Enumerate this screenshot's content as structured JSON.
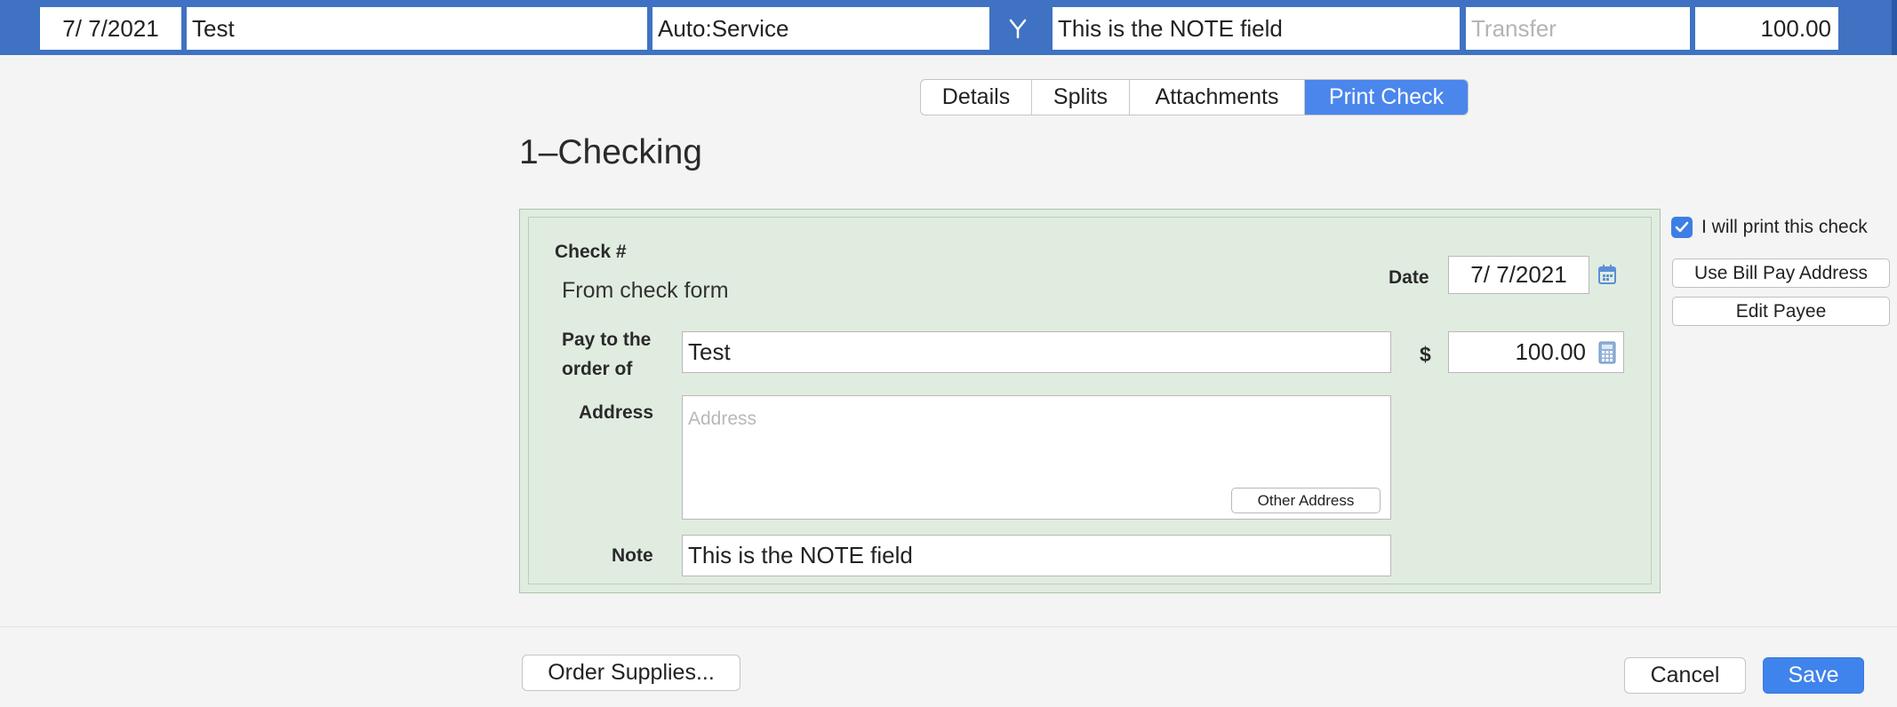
{
  "register": {
    "date": "7/  7/2021",
    "payee": "Test",
    "category": "Auto:Service",
    "memo": "This is the NOTE field",
    "transfer_placeholder": "Transfer",
    "amount": "100.00"
  },
  "tabs": [
    {
      "label": "Details",
      "active": false
    },
    {
      "label": "Splits",
      "active": false
    },
    {
      "label": "Attachments",
      "active": false
    },
    {
      "label": "Print Check",
      "active": true
    }
  ],
  "account_title": "1–Checking",
  "check": {
    "check_num_label": "Check #",
    "check_num_value": "From check form",
    "date_label": "Date",
    "date_value": "7/  7/2021",
    "pay_to_label_line1": "Pay to the",
    "pay_to_label_line2": "order of",
    "payee_value": "Test",
    "dollar_label": "$",
    "amount_value": "100.00",
    "address_label": "Address",
    "address_placeholder": "Address",
    "other_address_label": "Other Address",
    "note_label": "Note",
    "note_value": "This is the NOTE field"
  },
  "side": {
    "print_checkbox_label": "I will print this check",
    "print_checked": true,
    "bill_pay_label": "Use Bill Pay Address",
    "edit_payee_label": "Edit Payee"
  },
  "footer": {
    "order_supplies_label": "Order Supplies...",
    "cancel_label": "Cancel",
    "save_label": "Save"
  },
  "colors": {
    "header_blue": "#3f72c2",
    "accent_blue": "#4a86ec",
    "check_bg": "#e1ece1"
  }
}
